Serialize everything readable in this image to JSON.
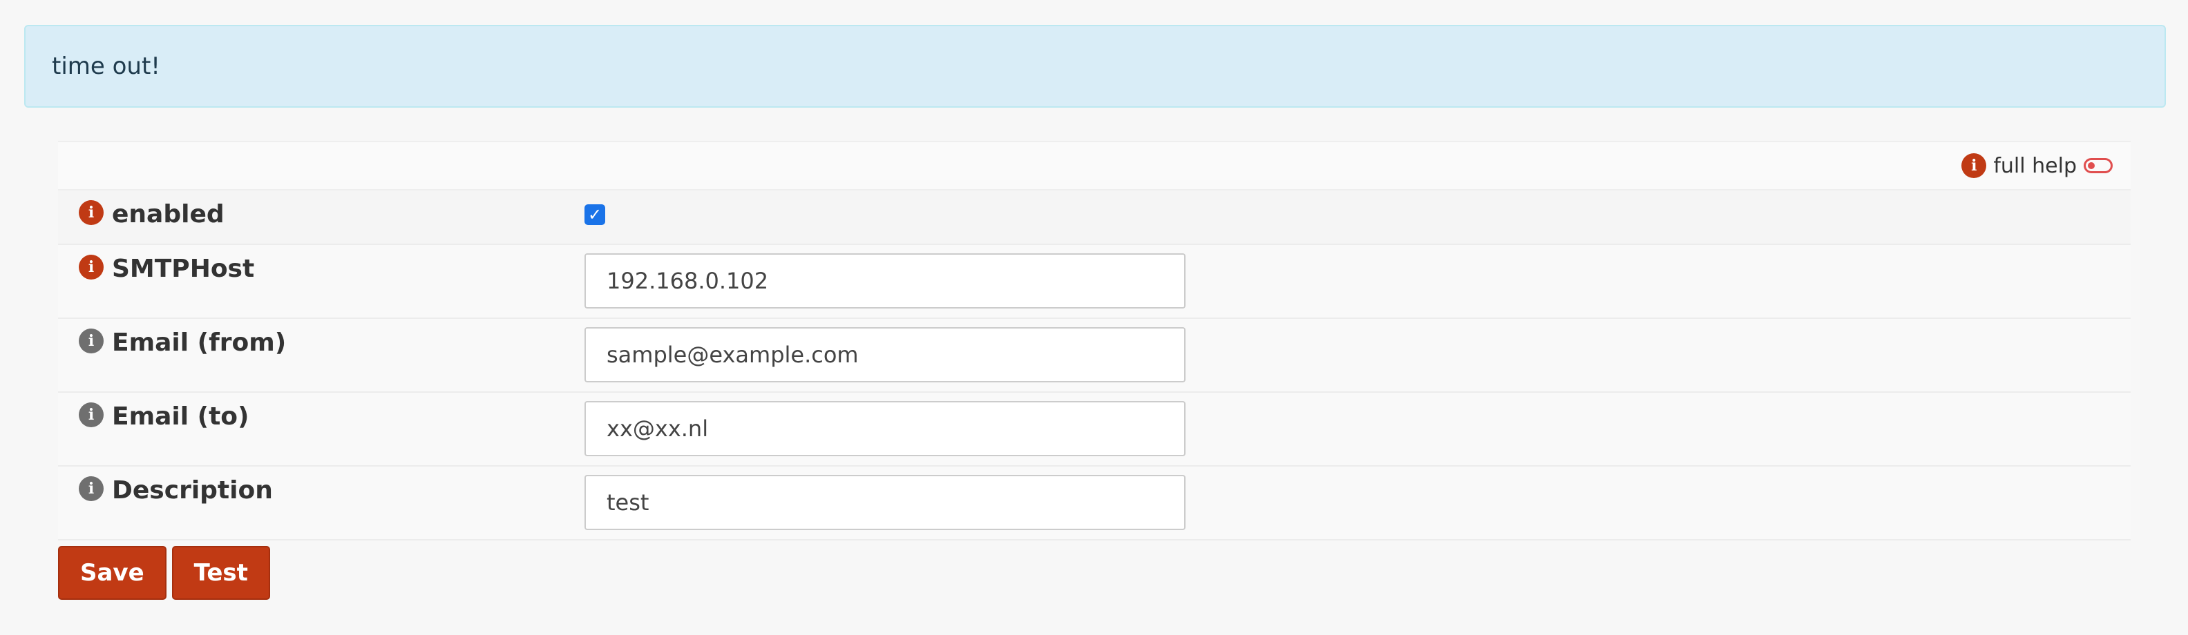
{
  "alert": {
    "message": "time out!"
  },
  "help": {
    "label": "full help"
  },
  "fields": {
    "enabled": {
      "label": "enabled",
      "checked": true
    },
    "smtp_host": {
      "label": "SMTPHost",
      "value": "192.168.0.102"
    },
    "email_from": {
      "label": "Email (from)",
      "value": "sample@example.com"
    },
    "email_to": {
      "label": "Email (to)",
      "value": "xx@xx.nl"
    },
    "description": {
      "label": "Description",
      "value": "test"
    }
  },
  "buttons": {
    "save": "Save",
    "test": "Test"
  },
  "icons": {
    "info": "info-icon",
    "toggle": "toggle-icon",
    "check": "checkmark-icon"
  },
  "colors": {
    "accent": "#c13a14",
    "info_red": "#c03a14",
    "info_gray": "#6f6f6f",
    "alert_bg": "#d9edf7",
    "checkbox": "#1a73e8"
  }
}
